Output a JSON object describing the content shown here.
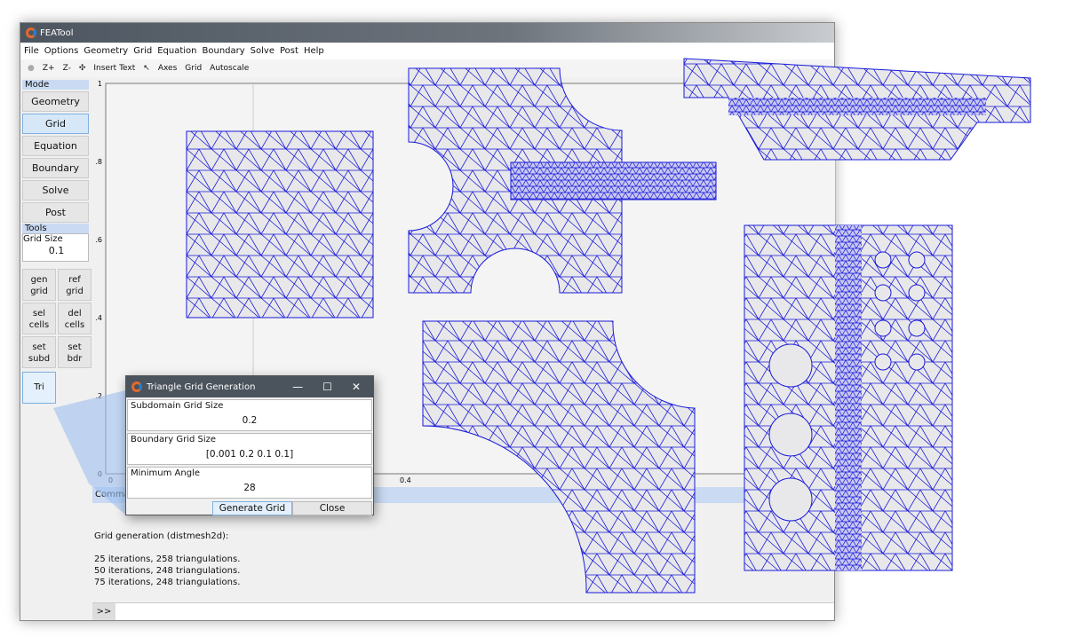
{
  "window": {
    "title": "FEATool"
  },
  "menu": [
    "File",
    "Options",
    "Geometry",
    "Grid",
    "Equation",
    "Boundary",
    "Solve",
    "Post",
    "Help"
  ],
  "toolbar": [
    "Z+",
    "Z-",
    "✣",
    "Insert Text",
    "↖",
    "Axes",
    "Grid",
    "Autoscale"
  ],
  "left": {
    "mode_label": "Mode",
    "modes": [
      {
        "label": "Geometry",
        "selected": false
      },
      {
        "label": "Grid",
        "selected": true
      },
      {
        "label": "Equation",
        "selected": false
      },
      {
        "label": "Boundary",
        "selected": false
      },
      {
        "label": "Solve",
        "selected": false
      },
      {
        "label": "Post",
        "selected": false
      }
    ],
    "tools_label": "Tools",
    "grid_size_label": "Grid Size",
    "grid_size_value": "0.1",
    "tools": [
      [
        "gen",
        "grid"
      ],
      [
        "ref",
        "grid"
      ],
      [
        "sel",
        "cells"
      ],
      [
        "del",
        "cells"
      ],
      [
        "set",
        "subd"
      ],
      [
        "set",
        "bdr"
      ]
    ],
    "tri_label": "Tri"
  },
  "plot": {
    "yticks": [
      "1",
      ".8",
      ".6",
      ".4",
      ".2",
      "0"
    ],
    "xticks": [
      "0",
      "0.4"
    ]
  },
  "dialog": {
    "title": "Triangle Grid Generation",
    "fields": [
      {
        "label": "Subdomain Grid Size",
        "value": "0.2"
      },
      {
        "label": "Boundary Grid Size",
        "value": "[0.001   0.2   0.1   0.1]"
      },
      {
        "label": "Minimum Angle",
        "value": "28"
      }
    ],
    "generate_label": "Generate Grid",
    "close_label": "Close"
  },
  "command": {
    "header": "Command Window",
    "lines": [
      "Grid generation (distmesh2d):",
      "",
      "25 iterations, 258 triangulations.",
      "50 iterations, 248 triangulations.",
      "75 iterations, 248 triangulations."
    ],
    "prompt": ">>"
  },
  "colors": {
    "mesh": "#1a1adb",
    "mesh_fill": "#e8e8ea",
    "accent": "#c9daf2"
  }
}
